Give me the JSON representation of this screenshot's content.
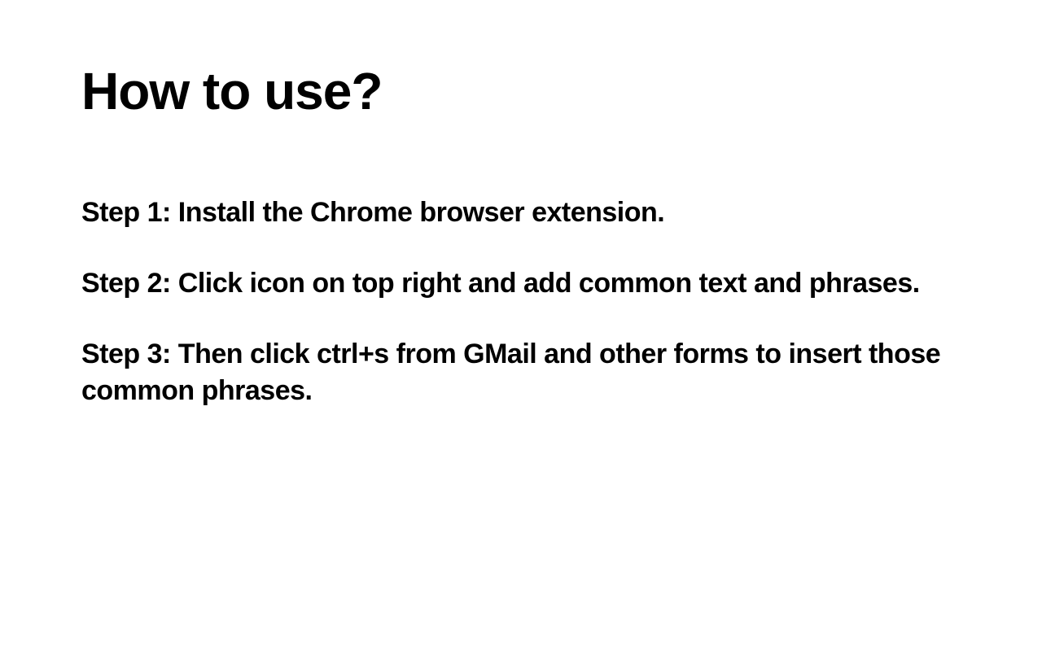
{
  "title": "How to use?",
  "steps": [
    "Step 1: Install the Chrome browser extension.",
    "Step 2: Click icon on top right and add common text and phrases.",
    "Step 3: Then click ctrl+s from GMail and other forms to insert those common phrases."
  ]
}
